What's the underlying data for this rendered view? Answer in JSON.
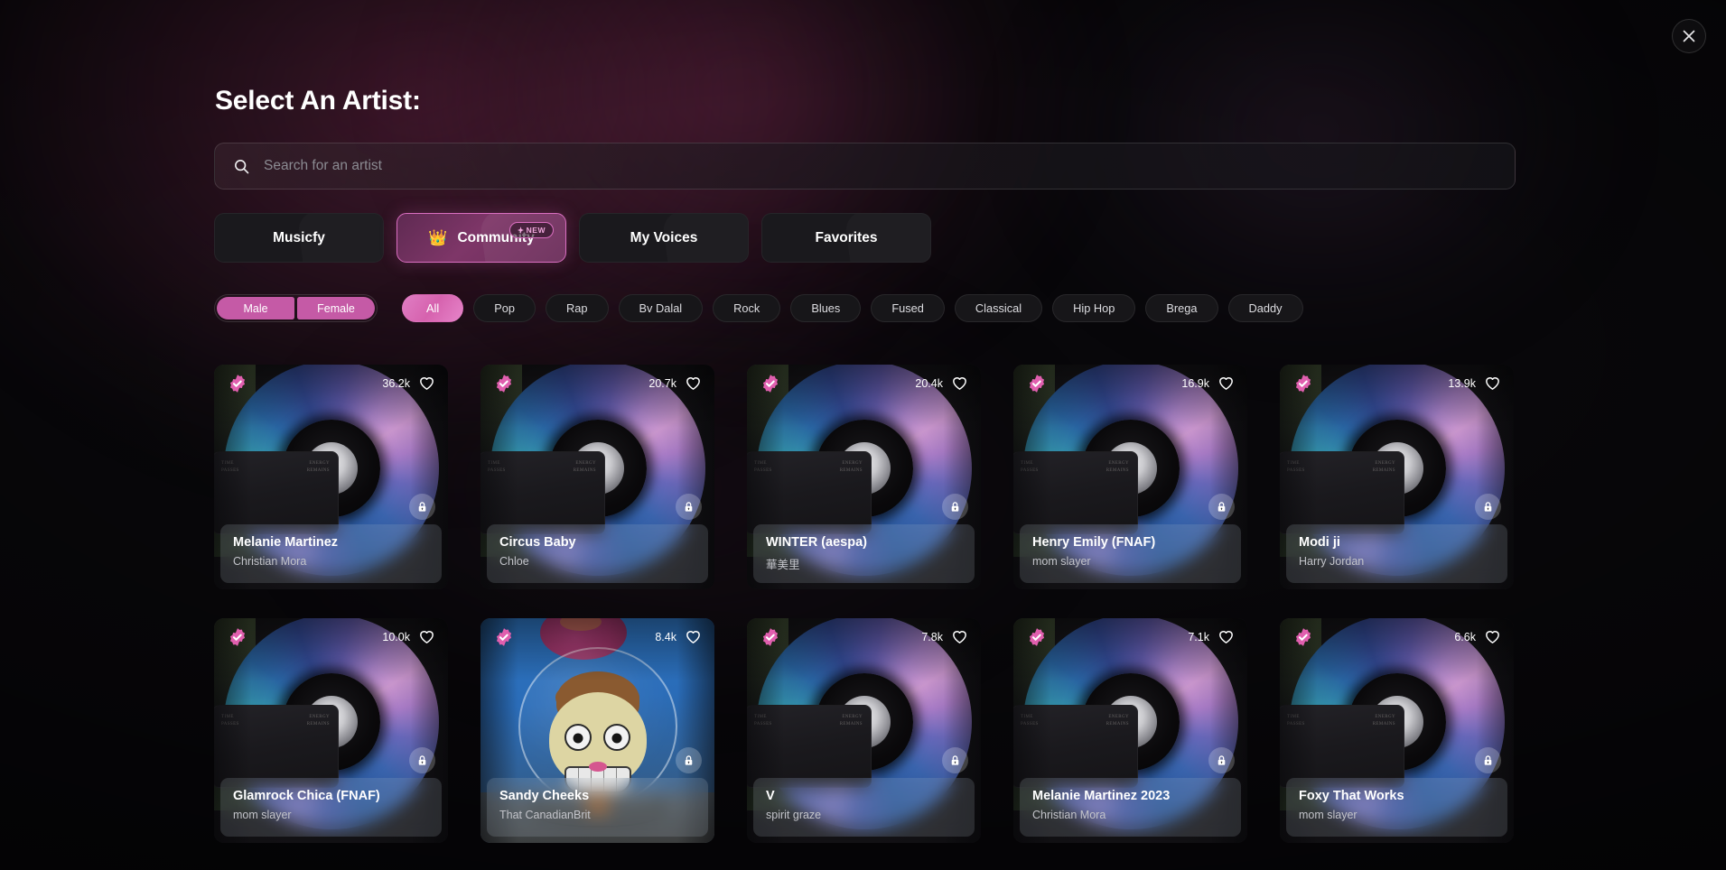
{
  "colors": {
    "accent_pink": "#d96ec0",
    "chip_active_pink": "#d662ae",
    "crown_gold": "#f5c518",
    "verified_pink": "#e05fae",
    "background": "#08070a"
  },
  "window": {
    "close_label": "×"
  },
  "header": {
    "title": "Select An Artist:"
  },
  "search": {
    "placeholder": "Search for an artist",
    "value": "",
    "icon": "search-icon"
  },
  "tabs": [
    {
      "label": "Musicfy",
      "active": false,
      "icon": null,
      "badge": null
    },
    {
      "label": "Community",
      "active": true,
      "icon": "crown-icon",
      "badge": "NEW"
    },
    {
      "label": "My Voices",
      "active": false,
      "icon": null,
      "badge": null
    },
    {
      "label": "Favorites",
      "active": false,
      "icon": null,
      "badge": null
    }
  ],
  "gender_filter": [
    {
      "label": "Male",
      "selected": true
    },
    {
      "label": "Female",
      "selected": true
    }
  ],
  "genre_filters": [
    {
      "label": "All",
      "active": true
    },
    {
      "label": "Pop",
      "active": false
    },
    {
      "label": "Rap",
      "active": false
    },
    {
      "label": "Bv Dalal",
      "active": false
    },
    {
      "label": "Rock",
      "active": false
    },
    {
      "label": "Blues",
      "active": false
    },
    {
      "label": "Fused",
      "active": false
    },
    {
      "label": "Classical",
      "active": false
    },
    {
      "label": "Hip Hop",
      "active": false
    },
    {
      "label": "Brega",
      "active": false
    },
    {
      "label": "Daddy",
      "active": false
    }
  ],
  "artwork_text": {
    "sleeve_left": "TIME PASSES",
    "sleeve_right": "ENERGY REMAINS"
  },
  "cards": [
    {
      "name": "Melanie Martinez",
      "creator": "Christian Mora",
      "likes": "36.2k",
      "verified": true,
      "locked": true,
      "art": "vinyl"
    },
    {
      "name": "Circus Baby",
      "creator": "Chloe",
      "likes": "20.7k",
      "verified": true,
      "locked": true,
      "art": "vinyl"
    },
    {
      "name": "WINTER (aespa)",
      "creator": "華美里",
      "likes": "20.4k",
      "verified": true,
      "locked": true,
      "art": "vinyl"
    },
    {
      "name": "Henry Emily (FNAF)",
      "creator": "mom slayer",
      "likes": "16.9k",
      "verified": true,
      "locked": true,
      "art": "vinyl"
    },
    {
      "name": "Modi ji",
      "creator": "Harry Jordan",
      "likes": "13.9k",
      "verified": true,
      "locked": true,
      "art": "vinyl"
    },
    {
      "name": "Glamrock Chica (FNAF)",
      "creator": "mom slayer",
      "likes": "10.0k",
      "verified": true,
      "locked": true,
      "art": "vinyl"
    },
    {
      "name": "Sandy Cheeks",
      "creator": "That CanadianBrit",
      "likes": "8.4k",
      "verified": true,
      "locked": true,
      "art": "sandy"
    },
    {
      "name": "V",
      "creator": "spirit graze",
      "likes": "7.8k",
      "verified": true,
      "locked": true,
      "art": "vinyl"
    },
    {
      "name": "Melanie Martinez 2023",
      "creator": "Christian Mora",
      "likes": "7.1k",
      "verified": true,
      "locked": true,
      "art": "vinyl"
    },
    {
      "name": "Foxy That Works",
      "creator": "mom slayer",
      "likes": "6.6k",
      "verified": true,
      "locked": true,
      "art": "vinyl"
    }
  ]
}
